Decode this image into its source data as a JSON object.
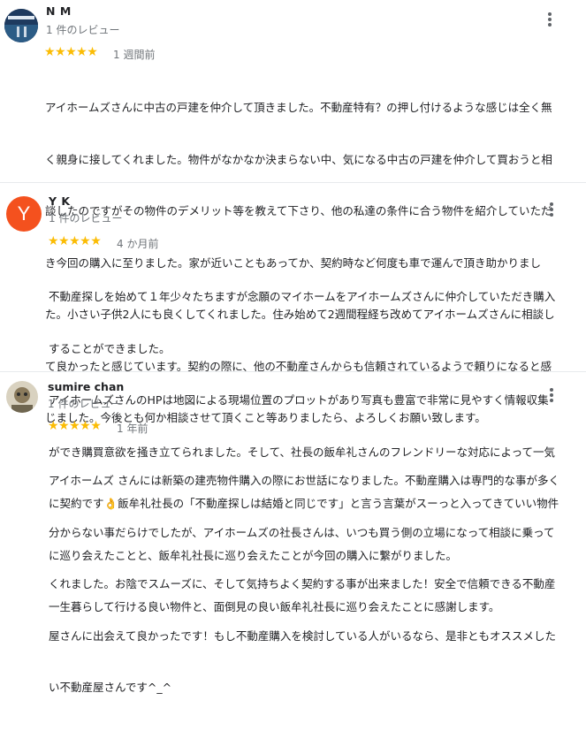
{
  "reviews": [
    {
      "name": "N M",
      "review_count": "1 件のレビュー",
      "stars": "★★★★★",
      "time": "1 週間前",
      "avatar_letter": "",
      "lines": [
        "アイホームズさんに中古の戸建を仲介して頂きました。不動産特有？の押し付けるような感じは全く無",
        "く親身に接してくれました。物件がなかなか決まらない中、気になる中古の戸建を仲介して買おうと相",
        "談したのですがその物件のデメリット等を教えて下さり、他の私達の条件に合う物件を紹介していただ",
        "き今回の購入に至りました。家が近いこともあってか、契約時など何度も車で運んで頂き助かりまし",
        "た。小さい子供2人にも良くしてくれました。住み始めて2週間程経ち改めてアイホームズさんに相談し",
        "て良かったと感じています。契約の際に、他の不動産さんからも信頼されているようで頼りになると感",
        "じました。今後とも何か相談させて頂くこと等ありましたら、よろしくお願い致します。"
      ]
    },
    {
      "name": "Y K",
      "review_count": "1 件のレビュー",
      "stars": "★★★★★",
      "time": "4 か月前",
      "avatar_letter": "Y",
      "lines": [
        "不動産探しを始めて１年少々たちますが念願のマイホームをアイホームズさんに仲介していただき購入",
        "することができました。",
        "アイホームズさんのHPは地図による現場位置のプロットがあり写真も豊富で非常に見やすく情報収集",
        "ができ購買意欲を掻き立てられました。そして、社長の飯牟礼さんのフレンドリーな対応によって一気",
        "に契約です👌飯牟礼社長の「不動産探しは結婚と同じです」と言う言葉がスーっと入ってきていい物件",
        "に巡り会えたことと、飯牟礼社長に巡り会えたことが今回の購入に繋がりました。",
        "一生暮らして行ける良い物件と、面倒見の良い飯牟礼社長に巡り会えたことに感謝します。"
      ]
    },
    {
      "name": "sumire chan",
      "review_count": "1 件のレビュー",
      "stars": "★★★★★",
      "time": "1 年前",
      "avatar_letter": "",
      "lines": [
        "アイホームズ さんには新築の建売物件購入の際にお世話になりました。不動産購入は専門的な事が多く",
        "分からない事だらけでしたが、アイホームズの社長さんは、いつも買う側の立場になって相談に乗って",
        "くれました。お陰でスムーズに、そして気持ちよく契約する事が出来ました！安全で信頼できる不動産",
        "屋さんに出会えて良かったです！もし不動産購入を検討している人がいるなら、是非ともオススメした",
        "い不動産屋さんです^_^"
      ]
    }
  ]
}
